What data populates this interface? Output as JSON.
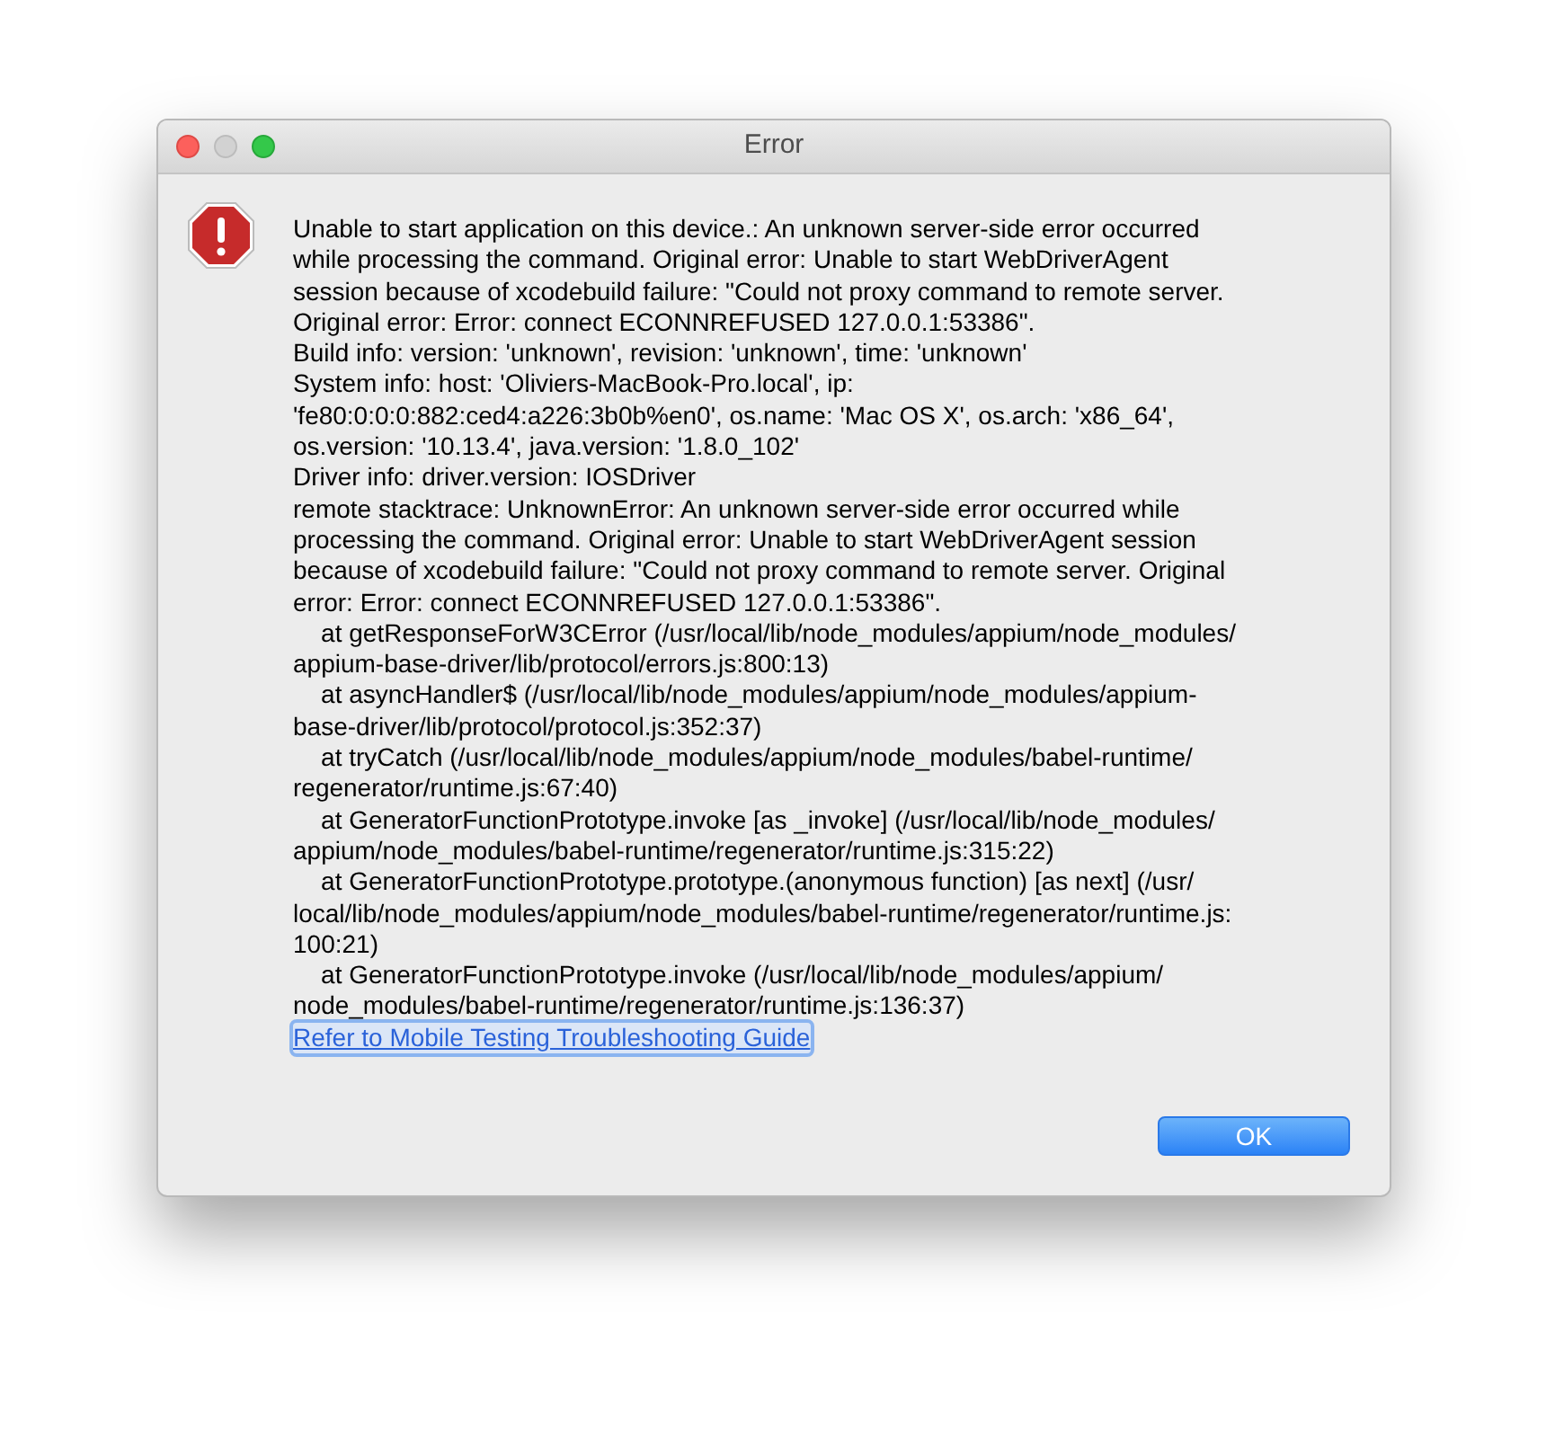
{
  "window": {
    "title": "Error"
  },
  "message_lines": [
    "Unable to start application on this device.: An unknown server-side error occurred",
    "while processing the command. Original error: Unable to start WebDriverAgent",
    "session because of xcodebuild failure: \"Could not proxy command to remote server.",
    "Original error: Error: connect ECONNREFUSED 127.0.0.1:53386\".",
    "Build info: version: 'unknown', revision: 'unknown', time: 'unknown'",
    "System info: host: 'Oliviers-MacBook-Pro.local', ip:",
    "'fe80:0:0:0:882:ced4:a226:3b0b%en0', os.name: 'Mac OS X', os.arch: 'x86_64',",
    "os.version: '10.13.4', java.version: '1.8.0_102'",
    "Driver info: driver.version: IOSDriver",
    "remote stacktrace: UnknownError: An unknown server-side error occurred while",
    "processing the command. Original error: Unable to start WebDriverAgent session",
    "because of xcodebuild failure: \"Could not proxy command to remote server. Original",
    "error: Error: connect ECONNREFUSED 127.0.0.1:53386\".",
    "    at getResponseForW3CError (/usr/local/lib/node_modules/appium/node_modules/",
    "appium-base-driver/lib/protocol/errors.js:800:13)",
    "    at asyncHandler$ (/usr/local/lib/node_modules/appium/node_modules/appium-",
    "base-driver/lib/protocol/protocol.js:352:37)",
    "    at tryCatch (/usr/local/lib/node_modules/appium/node_modules/babel-runtime/",
    "regenerator/runtime.js:67:40)",
    "    at GeneratorFunctionPrototype.invoke [as _invoke] (/usr/local/lib/node_modules/",
    "appium/node_modules/babel-runtime/regenerator/runtime.js:315:22)",
    "    at GeneratorFunctionPrototype.prototype.(anonymous function) [as next] (/usr/",
    "local/lib/node_modules/appium/node_modules/babel-runtime/regenerator/runtime.js:",
    "100:21)",
    "    at GeneratorFunctionPrototype.invoke (/usr/local/lib/node_modules/appium/",
    "node_modules/babel-runtime/regenerator/runtime.js:136:37)"
  ],
  "link": {
    "label": "Refer to Mobile Testing Troubleshooting Guide",
    "focused": true
  },
  "buttons": [
    {
      "label": "OK",
      "default": true
    }
  ]
}
